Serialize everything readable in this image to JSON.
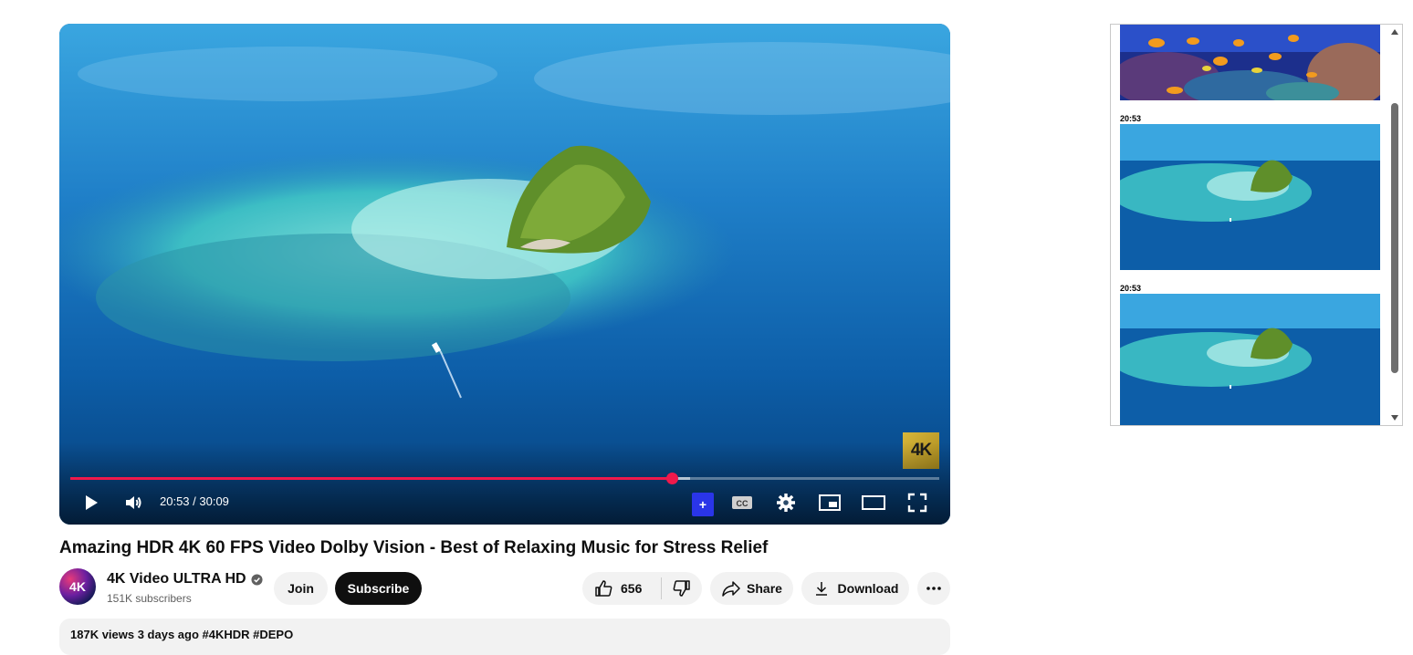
{
  "player": {
    "current_time": "20:53",
    "duration": "30:09",
    "time_display": "20:53 / 30:09",
    "progress": 0.6926,
    "buffered": 0.713,
    "watermark": "4K",
    "plus_label": "+",
    "accent_color": "#f0194b",
    "controls": {
      "play": "play-icon",
      "volume": "volume-icon",
      "captions": "cc-icon",
      "settings": "gear-icon",
      "miniplayer": "miniplayer-icon",
      "theater": "theater-icon",
      "fullscreen": "fullscreen-icon"
    }
  },
  "video": {
    "title": "Amazing HDR 4K 60 FPS Video Dolby Vision - Best of Relaxing Music for Stress Relief"
  },
  "channel": {
    "avatar_text": "4K",
    "name": "4K Video ULTRA HD",
    "subscribers": "151K subscribers"
  },
  "actions": {
    "join": "Join",
    "subscribe": "Subscribe",
    "like_count": "656",
    "share": "Share",
    "download": "Download"
  },
  "description": {
    "snippet": "187K views  3 days ago  #4KHDR  #DEPO"
  },
  "side_panel": {
    "thumbnails": [
      {
        "label": ""
      },
      {
        "label": "20:53"
      },
      {
        "label": "20:53"
      }
    ]
  }
}
